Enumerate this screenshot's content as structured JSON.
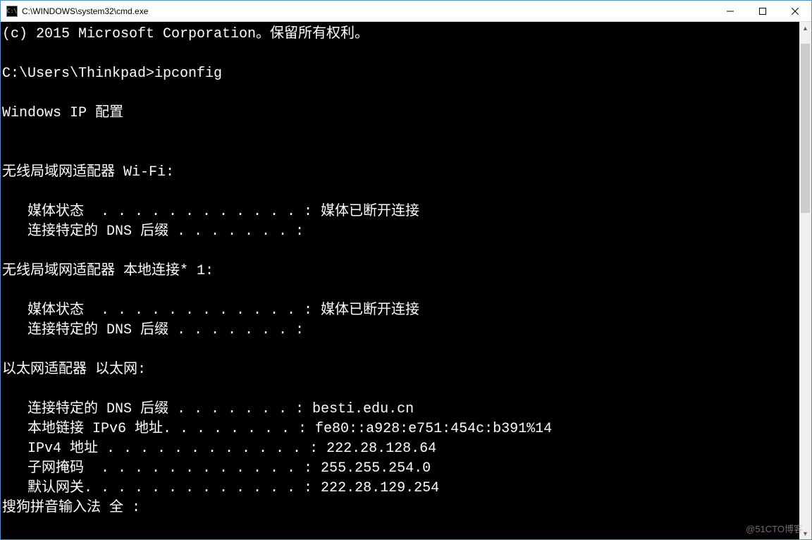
{
  "window": {
    "title": "C:\\WINDOWS\\system32\\cmd.exe",
    "icon_label": "C:\\"
  },
  "terminal": {
    "copyright": "(c) 2015 Microsoft Corporation。保留所有权利。",
    "blank": "",
    "prompt_line": "C:\\Users\\Thinkpad>ipconfig",
    "heading": "Windows IP 配置",
    "adapter1_title": "无线局域网适配器 Wi-Fi:",
    "adapter1_line1": "   媒体状态  . . . . . . . . . . . . : 媒体已断开连接",
    "adapter1_line2": "   连接特定的 DNS 后缀 . . . . . . . :",
    "adapter2_title": "无线局域网适配器 本地连接* 1:",
    "adapter2_line1": "   媒体状态  . . . . . . . . . . . . : 媒体已断开连接",
    "adapter2_line2": "   连接特定的 DNS 后缀 . . . . . . . :",
    "adapter3_title": "以太网适配器 以太网:",
    "adapter3_line1": "   连接特定的 DNS 后缀 . . . . . . . : besti.edu.cn",
    "adapter3_line2": "   本地链接 IPv6 地址. . . . . . . . : fe80::a928:e751:454c:b391%14",
    "adapter3_line3": "   IPv4 地址 . . . . . . . . . . . . : 222.28.128.64",
    "adapter3_line4": "   子网掩码  . . . . . . . . . . . . : 255.255.254.0",
    "adapter3_line5": "   默认网关. . . . . . . . . . . . . : 222.28.129.254",
    "ime_line": "搜狗拼音输入法 全 :"
  },
  "watermark": "@51CTO博客"
}
